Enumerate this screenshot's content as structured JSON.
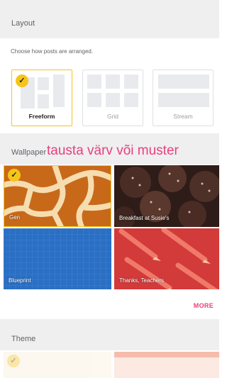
{
  "layout_section": {
    "title": "Layout",
    "description": "Choose how posts are arranged.",
    "options": [
      {
        "label": "Freeform",
        "selected": true
      },
      {
        "label": "Grid",
        "selected": false
      },
      {
        "label": "Stream",
        "selected": false
      }
    ]
  },
  "wallpaper_section": {
    "title": "Wallpaper",
    "overlay_text": "tausta värv või muster",
    "tiles": [
      {
        "label": "Gen",
        "selected": true
      },
      {
        "label": "Breakfast at Susie's",
        "selected": false
      },
      {
        "label": "Blueprint",
        "selected": false
      },
      {
        "label": "Thanks, Teachers",
        "selected": false
      }
    ],
    "more_label": "MORE"
  },
  "theme_section": {
    "title": "Theme"
  },
  "colors": {
    "accent": "#e8407e",
    "selection": "#f5c518",
    "section_bg": "#efefef"
  },
  "icons": {
    "check": "checkmark-icon"
  }
}
